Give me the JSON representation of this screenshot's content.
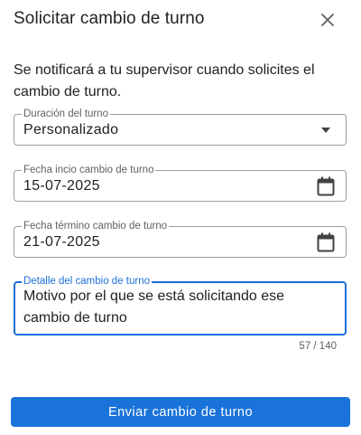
{
  "dialog": {
    "title": "Solicitar cambio de turno",
    "message": "Se notificará a tu supervisor cuando solicites el cambio de turno."
  },
  "form": {
    "shift_duration": {
      "label": "Duración del turno",
      "value": "Personalizado"
    },
    "start_date": {
      "label": "Fecha incio cambio de turno",
      "value": "15-07-2025"
    },
    "end_date": {
      "label": "Fecha término cambio de turno",
      "value": "21-07-2025"
    },
    "detail": {
      "label": "Detalle del cambio de turno",
      "value": "Motivo por el que se está solicitando ese cambio de turno",
      "counter": "57 / 140"
    },
    "submit_label": "Enviar cambio de turno"
  },
  "icons": {
    "close": "close-icon",
    "dropdown": "dropdown-arrow-icon",
    "calendar": "calendar-icon"
  },
  "colors": {
    "accent": "#1a73d9",
    "border": "#9e9e9e",
    "focused_border": "#1e6fd9"
  }
}
